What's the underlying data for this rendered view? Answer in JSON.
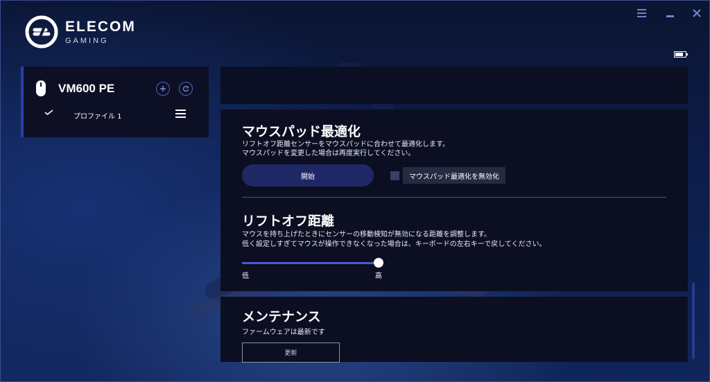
{
  "app": {
    "brand": "ELECOM",
    "sub_brand": "GAMING"
  },
  "window_controls": {
    "menu_icon": "menu-icon",
    "minimize_icon": "minimize-icon",
    "close_icon": "close-icon"
  },
  "battery": {
    "level": 0.75
  },
  "device": {
    "name": "VM600 PE",
    "profile": "プロファイル 1"
  },
  "pad_optimization": {
    "title": "マウスパッド最適化",
    "desc_line1": "リフトオフ距離センサーをマウスパッドに合わせて最適化します。",
    "desc_line2": "マウスパッドを変更した場合は再度実行してください。",
    "start_label": "開始",
    "disable_label": "マウスパッド最適化を無効化",
    "disable_checked": false
  },
  "liftoff": {
    "title": "リフトオフ距離",
    "desc_line1": "マウスを持ち上げたときにセンサーの移動検知が無効になる距離を調整します。",
    "desc_line2": "低く設定しすぎてマウスが操作できなくなった場合は、キーボードの左右キーで戻してください。",
    "low_label": "低",
    "high_label": "高",
    "value": 1.0
  },
  "maintenance": {
    "title": "メンテナンス",
    "firmware_status": "ファームウェアは最新です",
    "update_label": "更新"
  },
  "colors": {
    "accent": "#2b3fa8",
    "button": "#1f2765",
    "panel": "#0c0f22"
  }
}
